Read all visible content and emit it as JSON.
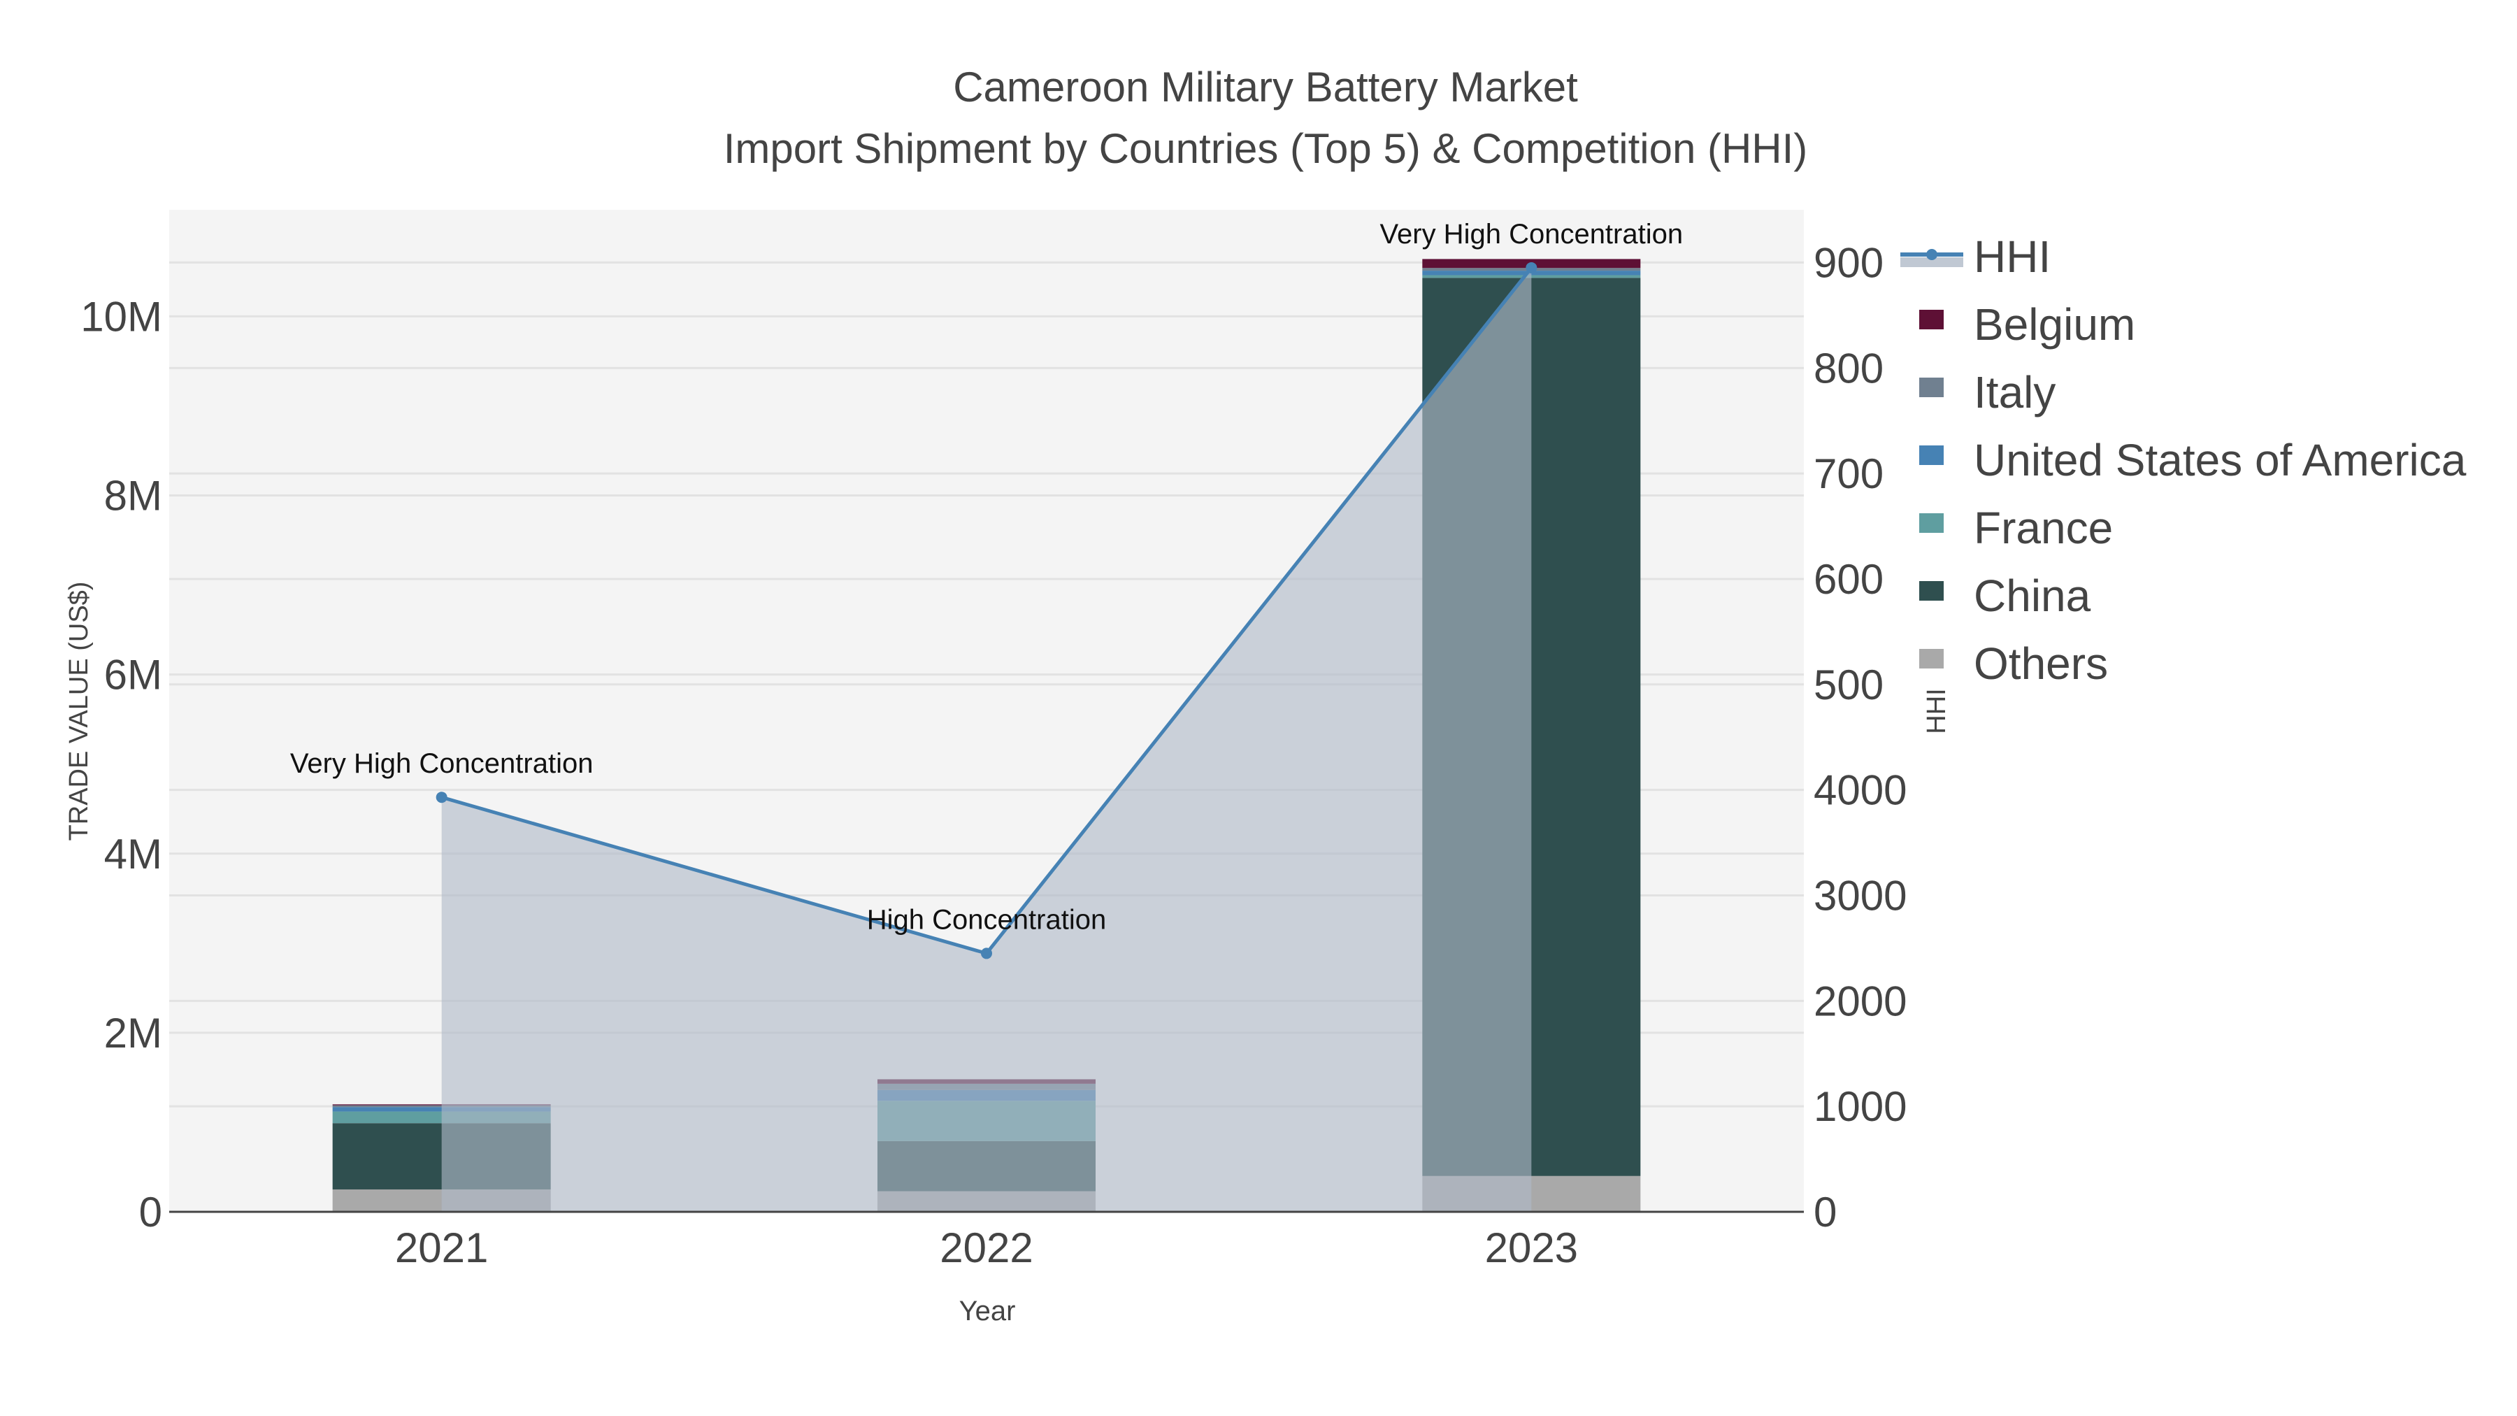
{
  "chart_data": {
    "type": "bar",
    "title": "Cameroon Military Battery Market",
    "subtitle": "Import Shipment by Countries (Top 5) & Competition (HHI)",
    "xlabel": "Year",
    "ylabel": "TRADE VALUE (US$)",
    "y2label": "HHI",
    "categories": [
      "2021",
      "2022",
      "2023"
    ],
    "ylim": [
      0,
      11190000
    ],
    "y_ticks": [
      0,
      2000000,
      4000000,
      6000000,
      8000000,
      10000000
    ],
    "y_tick_labels": [
      "0",
      "2M",
      "4M",
      "6M",
      "8M",
      "10M"
    ],
    "y2lim": [
      0,
      9500
    ],
    "y2_ticks": [
      0,
      1000,
      2000,
      3000,
      4000,
      5000,
      6000,
      7000,
      8000,
      9000
    ],
    "y2_tick_labels": [
      "0",
      "1000",
      "2000",
      "3000",
      "4000",
      "500",
      "600",
      "700",
      "800",
      "900"
    ],
    "grid": true,
    "legend_placement": "right",
    "series": [
      {
        "name": "Others",
        "color": "#a9a9a9",
        "values": [
          250000,
          230000,
          400000
        ]
      },
      {
        "name": "China",
        "color": "#2f4f4f",
        "values": [
          740000,
          560000,
          10030000
        ]
      },
      {
        "name": "France",
        "color": "#5f9ea0",
        "values": [
          130000,
          450000,
          30000
        ]
      },
      {
        "name": "United States of America",
        "color": "#4682b4",
        "values": [
          50000,
          120000,
          50000
        ]
      },
      {
        "name": "Italy",
        "color": "#708090",
        "values": [
          20000,
          70000,
          30000
        ]
      },
      {
        "name": "Belgium",
        "color": "#5e1035",
        "values": [
          10000,
          50000,
          100000
        ]
      }
    ],
    "line": {
      "name": "HHI",
      "color": "#4682b4",
      "values": [
        3930,
        2450,
        8950
      ]
    },
    "annotations": [
      "Very High Concentration",
      "High Concentration",
      "Very High Concentration"
    ],
    "legend_order": [
      "HHI",
      "Belgium",
      "Italy",
      "United States of America",
      "France",
      "China",
      "Others"
    ]
  }
}
